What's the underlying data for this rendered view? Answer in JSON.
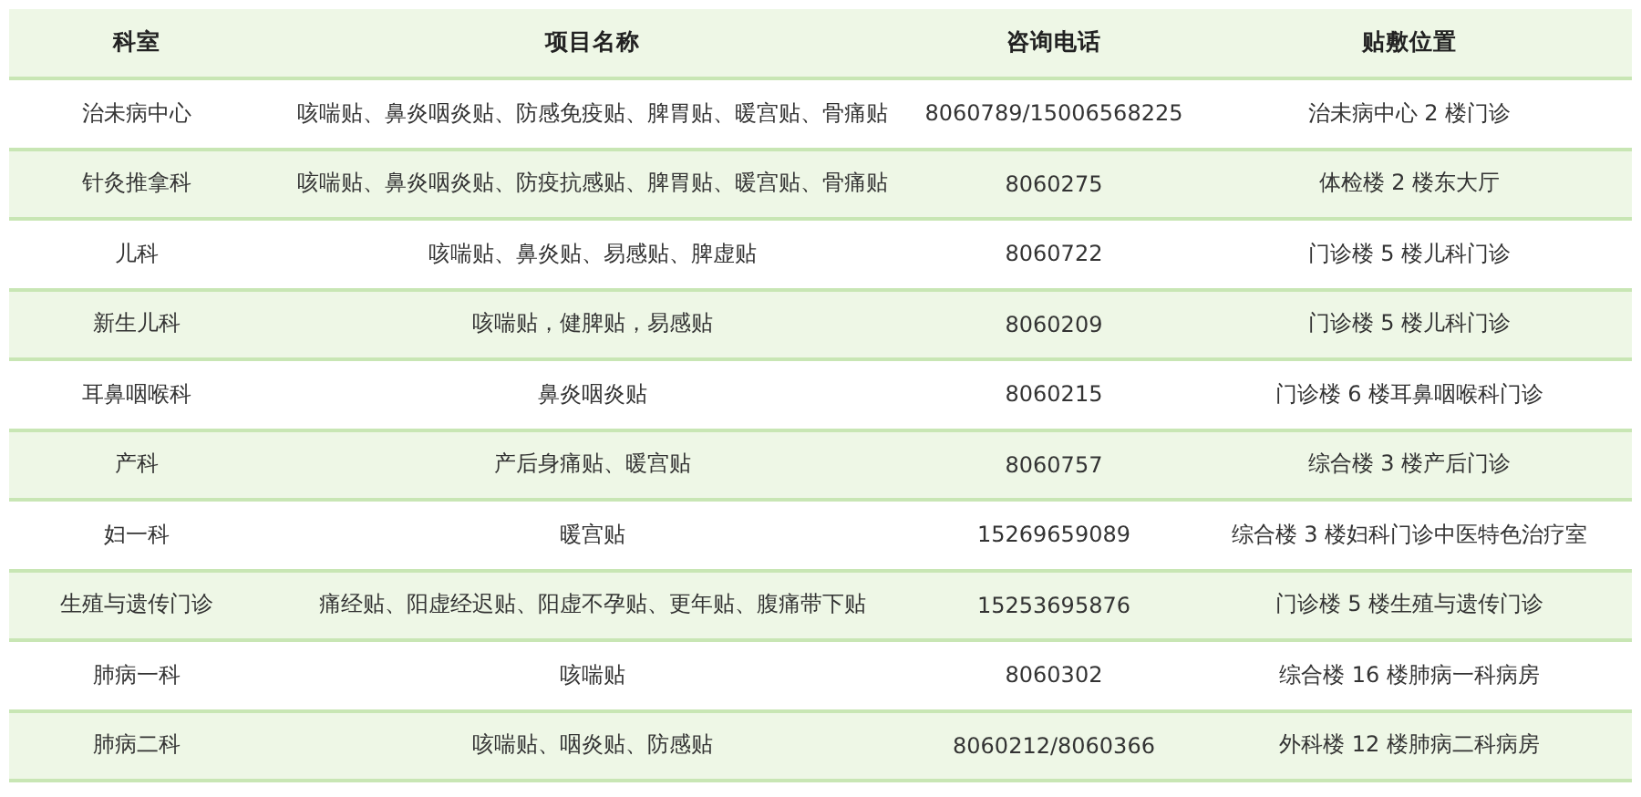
{
  "table": {
    "columns": [
      "科室",
      "项目名称",
      "咨询电话",
      "贴敷位置"
    ],
    "rows": [
      [
        "治未病中心",
        "咳喘贴、鼻炎咽炎贴、防感免疫贴、脾胃贴、暖宫贴、骨痛贴",
        "8060789/15006568225",
        "治未病中心 2 楼门诊"
      ],
      [
        "针灸推拿科",
        "咳喘贴、鼻炎咽炎贴、防疫抗感贴、脾胃贴、暖宫贴、骨痛贴",
        "8060275",
        "体检楼 2 楼东大厅"
      ],
      [
        "儿科",
        "咳喘贴、鼻炎贴、易感贴、脾虚贴",
        "8060722",
        "门诊楼 5 楼儿科门诊"
      ],
      [
        "新生儿科",
        "咳喘贴，健脾贴，易感贴",
        "8060209",
        "门诊楼 5 楼儿科门诊"
      ],
      [
        "耳鼻咽喉科",
        "鼻炎咽炎贴",
        "8060215",
        "门诊楼 6 楼耳鼻咽喉科门诊"
      ],
      [
        "产科",
        "产后身痛贴、暖宫贴",
        "8060757",
        "综合楼 3 楼产后门诊"
      ],
      [
        "妇一科",
        "暖宫贴",
        "15269659089",
        "综合楼 3 楼妇科门诊中医特色治疗室"
      ],
      [
        "生殖与遗传门诊",
        "痛经贴、阳虚经迟贴、阳虚不孕贴、更年贴、腹痛带下贴",
        "15253695876",
        "门诊楼 5 楼生殖与遗传门诊"
      ],
      [
        "肺病一科",
        "咳喘贴",
        "8060302",
        "综合楼 16 楼肺病一科病房"
      ],
      [
        "肺病二科",
        "咳喘贴、咽炎贴、防感贴",
        "8060212/8060366",
        "外科楼 12 楼肺病二科病房"
      ]
    ]
  }
}
